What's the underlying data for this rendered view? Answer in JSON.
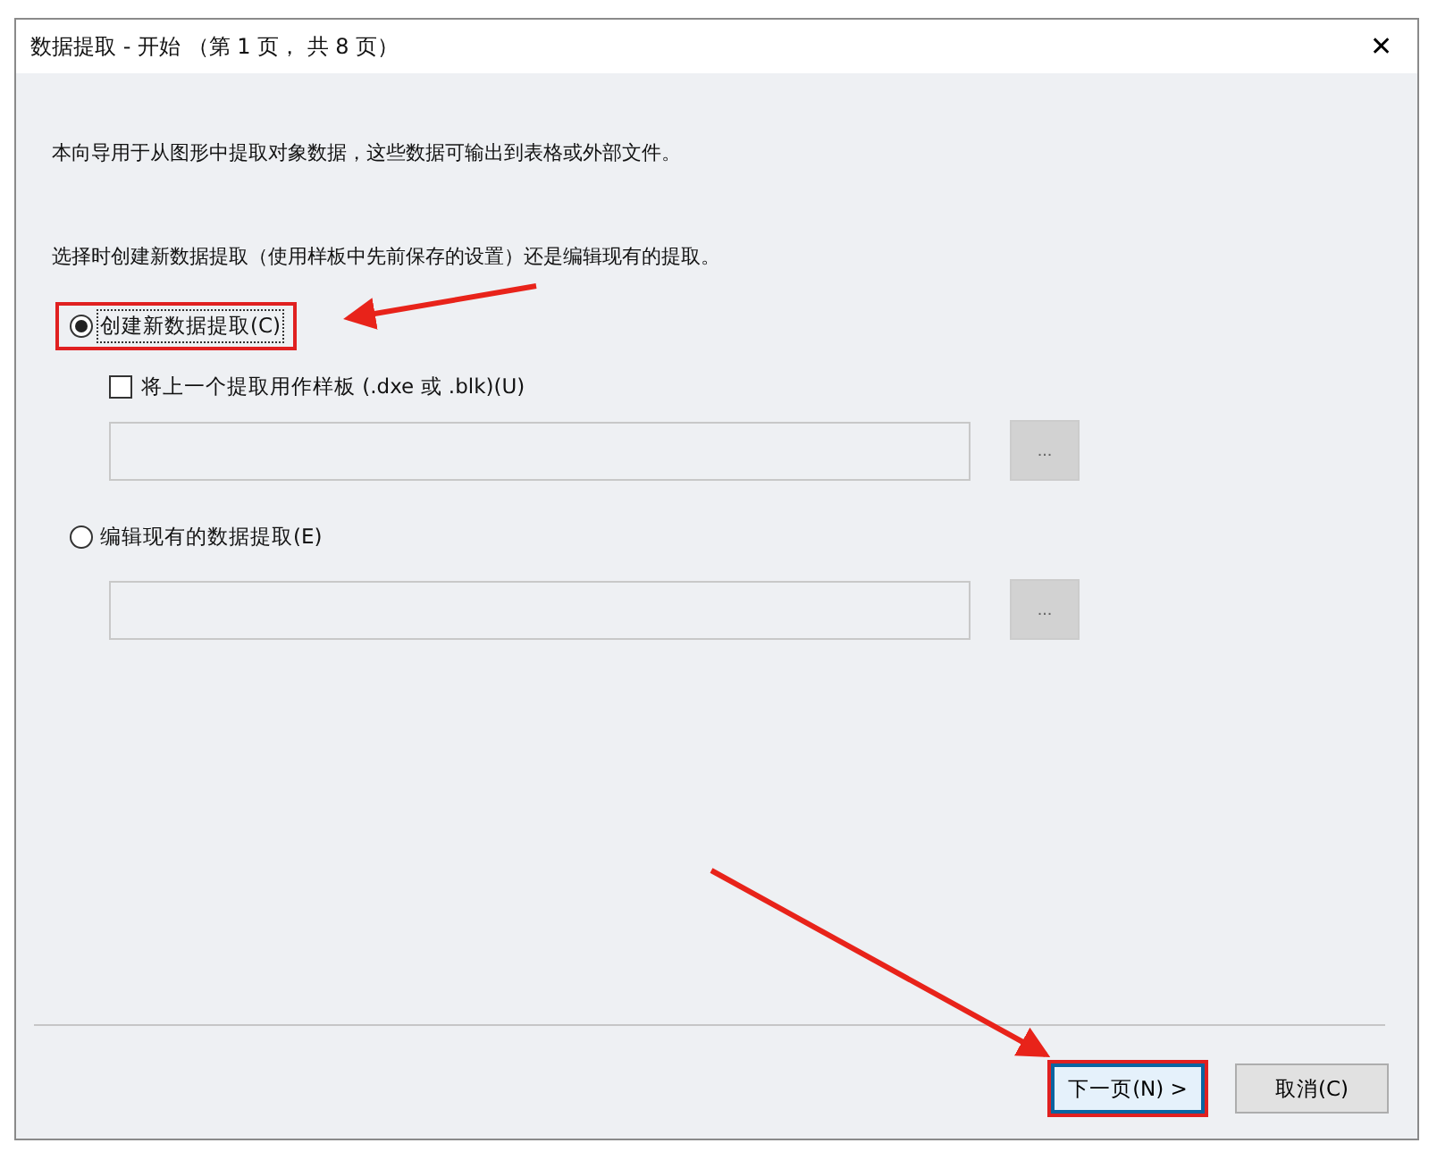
{
  "window": {
    "title": "数据提取 - 开始 （第 1 页， 共 8 页）",
    "close": "✕"
  },
  "intro": "本向导用于从图形中提取对象数据，这些数据可输出到表格或外部文件。",
  "prompt": "选择时创建新数据提取（使用样板中先前保存的设置）还是编辑现有的提取。",
  "options": [
    {
      "label": "创建新数据提取(C)",
      "selected": true,
      "highlighted": true,
      "checkbox": {
        "label": "将上一个提取用作样板 (.dxe 或 .blk)(U)",
        "checked": false
      },
      "field": {
        "disabled": true
      },
      "browse": "..."
    },
    {
      "label": "编辑现有的数据提取(E)",
      "selected": false,
      "highlighted": false,
      "field": {
        "disabled": true
      },
      "browse": "..."
    }
  ],
  "buttons": [
    {
      "label": "下一页(N) >",
      "default": true,
      "highlighted": true
    },
    {
      "label": "取消(C)",
      "default": false,
      "highlighted": false
    }
  ]
}
